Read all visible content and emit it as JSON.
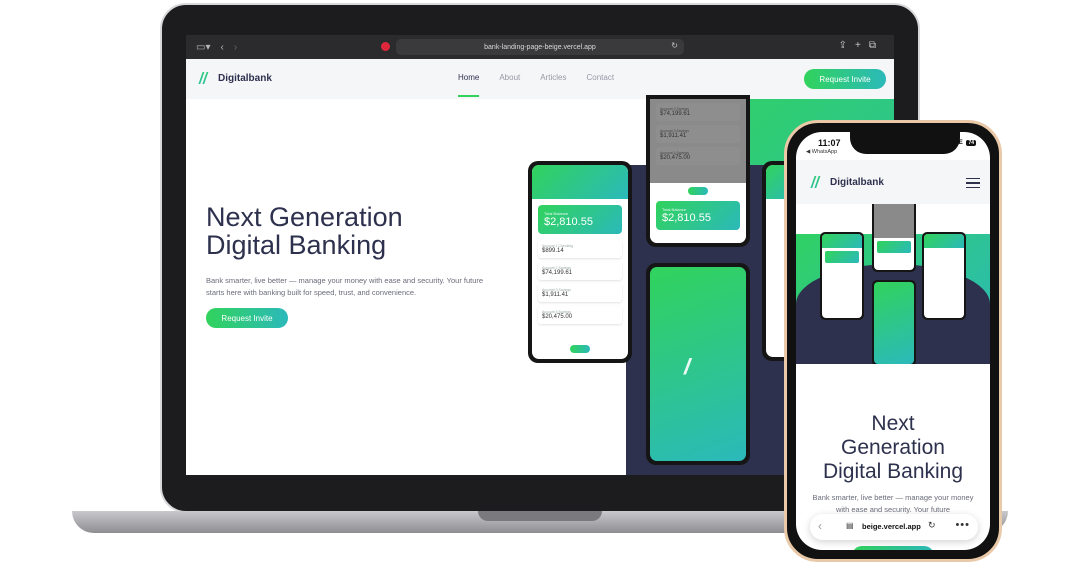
{
  "browser": {
    "url": "bank-landing-page-beige.vercel.app",
    "reload_icon": "reload-icon",
    "share_icon": "share-icon",
    "new_tab_icon": "plus-icon",
    "tabs_icon": "tabs-icon"
  },
  "site": {
    "logo_text": "Digitalbank",
    "nav": [
      {
        "label": "Home"
      },
      {
        "label": "About"
      },
      {
        "label": "Articles"
      },
      {
        "label": "Contact"
      }
    ],
    "cta_label": "Request Invite",
    "hero_title_line1": "Next Generation",
    "hero_title_line2": "Digital Banking",
    "hero_text": "Bank smarter, live better — manage your money with ease and security. Your future starts here with banking built for speed, trust, and convenience.",
    "hero_cta_label": "Request Invite"
  },
  "mockups": {
    "left": {
      "balance_label": "Total Balance",
      "balance_value": "$2,810.55",
      "accounts": [
        {
          "label": "Account 1 Checking",
          "value": "$899.14"
        },
        {
          "label": "Account 2 Savings",
          "value": "$74,199.61"
        },
        {
          "label": "Account 3 Savings",
          "value": "$1,911.41"
        },
        {
          "label": "Account 4 Savings",
          "value": "$20,475.00"
        }
      ]
    },
    "top": {
      "accounts": [
        {
          "label": "Account 2 Savings",
          "value": "$74,199.61"
        },
        {
          "label": "Account 3 Savings",
          "value": "$1,911.41"
        },
        {
          "label": "Account 4 Savings",
          "value": "$20,475.00"
        }
      ],
      "balance_label": "Total Balance",
      "balance_value": "$2,810.55"
    }
  },
  "phone": {
    "time": "11:07",
    "back_label": "◀ WhatsApp",
    "network": "LTE",
    "battery": "74",
    "logo_text": "Digitalbank",
    "hero_title_line1": "Next",
    "hero_title_line2": "Generation",
    "hero_title_line3": "Digital Banking",
    "hero_text": "Bank smarter, live better — manage your money with ease and security. Your future",
    "url_short": "beige.vercel.app"
  },
  "colors": {
    "accent_green": "#31d35c",
    "accent_cyan": "#2bb9ba",
    "navy": "#2d314d"
  }
}
